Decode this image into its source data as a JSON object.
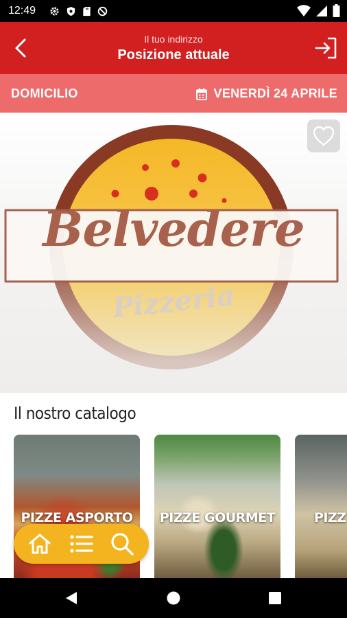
{
  "status_bar": {
    "time": "12:49",
    "left_icons": [
      "gear-icon",
      "shield-icon",
      "sdcard-icon",
      "no-disturb-icon"
    ],
    "right_icons": [
      "wifi-icon",
      "signal-icon",
      "battery-icon"
    ]
  },
  "header": {
    "subtitle": "Il tuo indirizzo",
    "title": "Posizione attuale",
    "left_icon": "back-arrow-icon",
    "right_icon": "login-icon"
  },
  "delivery": {
    "mode": "DOMICILIO",
    "date": "VENERDÌ 24 APRILE",
    "date_icon": "calendar-icon"
  },
  "brand": {
    "name": "Belvedere",
    "tagline": "Pizzeria"
  },
  "catalog": {
    "title": "Il nostro catalogo",
    "items": [
      {
        "label": "PIZZE ASPORTO"
      },
      {
        "label": "PIZZE GOURMET"
      },
      {
        "label": "PIZZ"
      }
    ]
  },
  "bottom_nav": {
    "items": [
      "home-icon",
      "list-icon",
      "search-icon"
    ]
  },
  "colors": {
    "primary": "#d21f1f",
    "strip": "#ee6b6b",
    "accent": "#f3b41f"
  }
}
